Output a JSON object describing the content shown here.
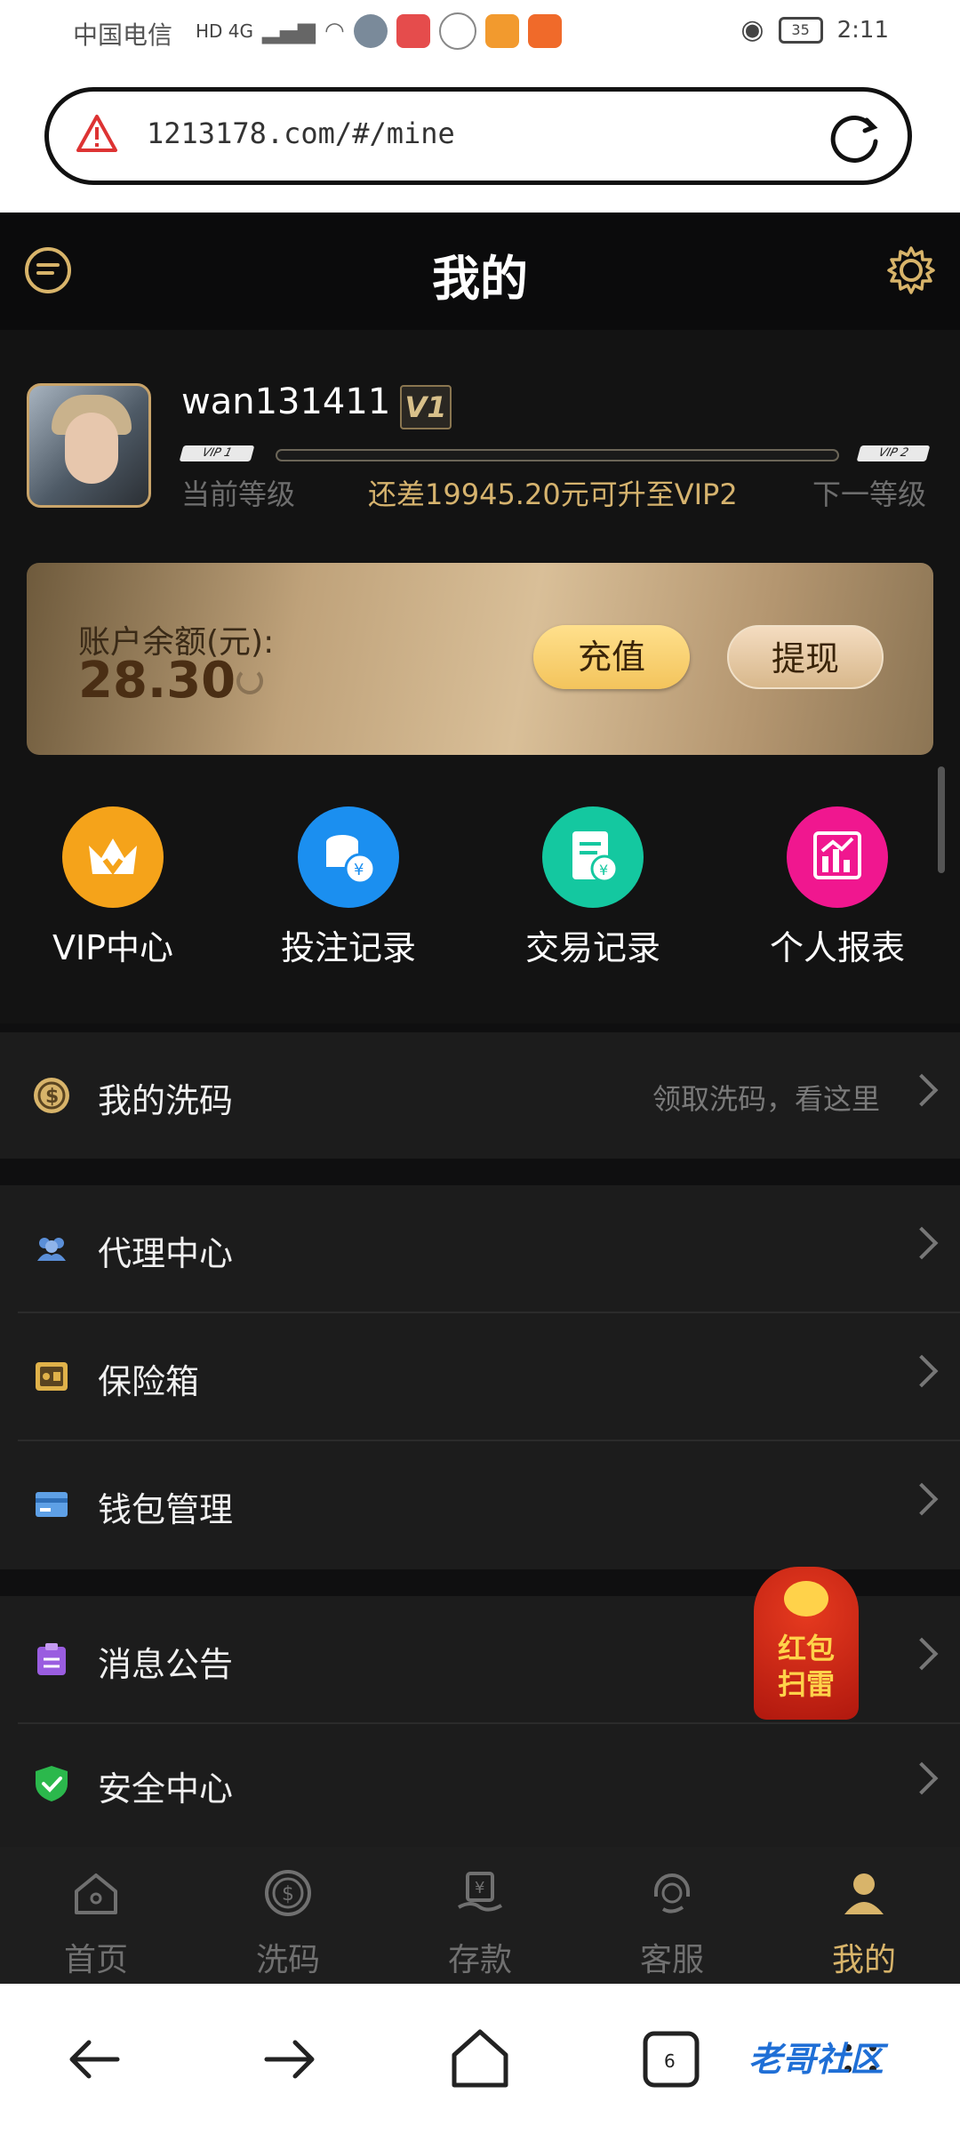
{
  "status_bar": {
    "carrier": "中国电信",
    "network": "HD 4G",
    "battery": "35",
    "time": "2:11"
  },
  "url_bar": {
    "url": "1213178.com/#/mine"
  },
  "header": {
    "title": "我的"
  },
  "profile": {
    "username": "wan131411",
    "vip_badge": "V1",
    "vip_current": "VIP 1",
    "vip_next": "VIP 2",
    "current_level_label": "当前等级",
    "next_level_label": "下一等级",
    "upgrade_text": "还差19945.20元可升至VIP2",
    "progress_fraction": 0.0
  },
  "balance": {
    "label": "账户余额(元):",
    "amount": "28.30",
    "recharge_label": "充值",
    "withdraw_label": "提现"
  },
  "quick_actions": [
    {
      "label": "VIP中心",
      "icon": "vip-crown-icon",
      "color": "#f5a31a"
    },
    {
      "label": "投注记录",
      "icon": "coins-stack-icon",
      "color": "#1b8ff0"
    },
    {
      "label": "交易记录",
      "icon": "receipt-icon",
      "color": "#14c8a0"
    },
    {
      "label": "个人报表",
      "icon": "bar-chart-icon",
      "color": "#f0178f"
    }
  ],
  "menu": {
    "rebate": {
      "label": "我的洗码",
      "hint": "领取洗码，看这里"
    },
    "agent": {
      "label": "代理中心"
    },
    "safe": {
      "label": "保险箱"
    },
    "wallet": {
      "label": "钱包管理"
    },
    "notice": {
      "label": "消息公告"
    },
    "security": {
      "label": "安全中心"
    }
  },
  "floating": {
    "red_envelope_text": "红包扫雷"
  },
  "bottom_nav": [
    {
      "label": "首页",
      "icon": "home-icon"
    },
    {
      "label": "洗码",
      "icon": "rebate-coin-icon"
    },
    {
      "label": "存款",
      "icon": "deposit-icon"
    },
    {
      "label": "客服",
      "icon": "support-icon"
    },
    {
      "label": "我的",
      "icon": "user-icon",
      "active": true
    }
  ],
  "watermark": "老哥社区"
}
